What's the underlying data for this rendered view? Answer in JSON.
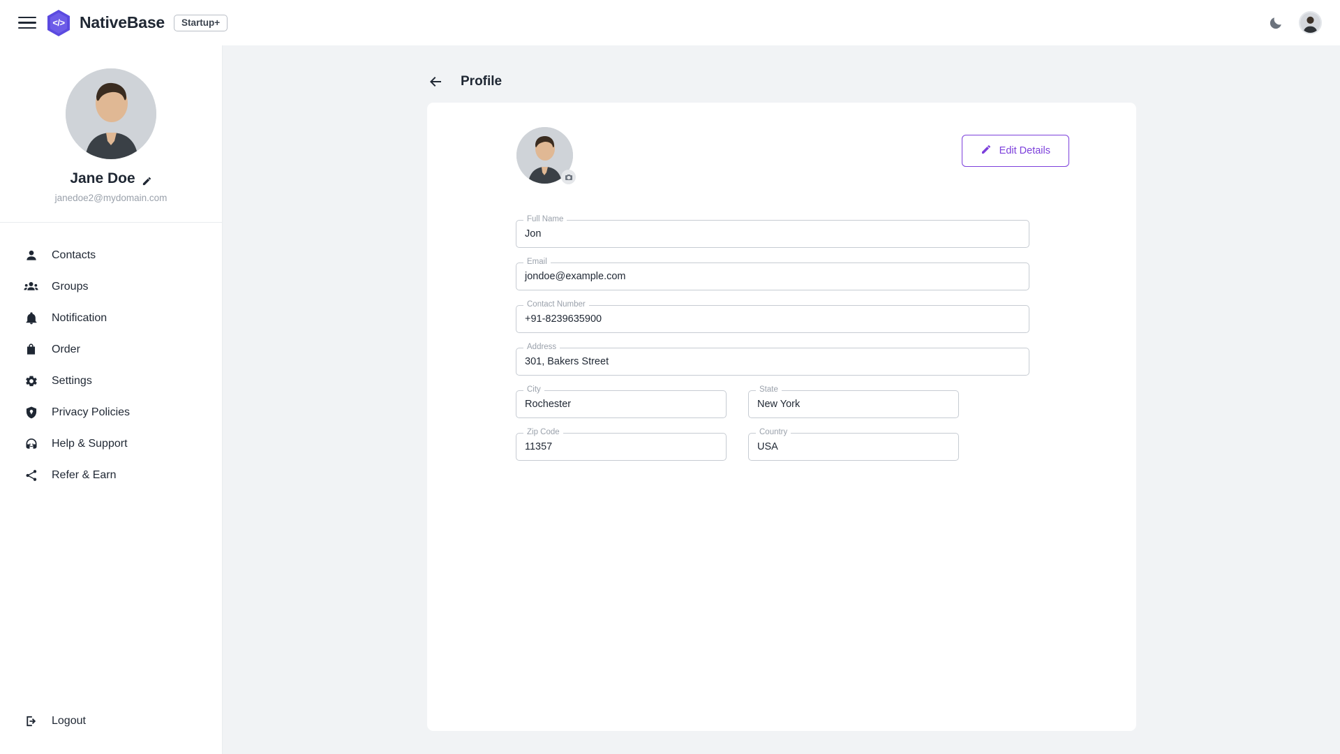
{
  "topbar": {
    "menu_icon": "hamburger-menu-icon",
    "logo_icon": "nativebase-hexagon-logo",
    "logo_glyph": "</>",
    "brand": "NativeBase",
    "badge": "Startup+",
    "theme_toggle_icon": "moon-icon",
    "avatar_icon": "user-avatar"
  },
  "sidebar": {
    "profile": {
      "name": "Jane Doe",
      "email": "janedoe2@mydomain.com",
      "edit_icon": "pencil-icon",
      "avatar_icon": "profile-photo"
    },
    "items": [
      {
        "label": "Contacts",
        "icon": "person-icon"
      },
      {
        "label": "Groups",
        "icon": "people-group-icon"
      },
      {
        "label": "Notification",
        "icon": "bell-icon"
      },
      {
        "label": "Order",
        "icon": "shopping-bag-icon"
      },
      {
        "label": "Settings",
        "icon": "gear-icon"
      },
      {
        "label": "Privacy Policies",
        "icon": "shield-icon"
      },
      {
        "label": "Help & Support",
        "icon": "headset-icon"
      },
      {
        "label": "Refer & Earn",
        "icon": "share-icon"
      }
    ],
    "logout": {
      "label": "Logout",
      "icon": "logout-arrow-icon"
    }
  },
  "page": {
    "back_icon": "back-arrow-icon",
    "title": "Profile"
  },
  "profile_card": {
    "avatar_icon": "profile-photo",
    "camera_icon": "camera-icon",
    "edit_button": {
      "label": "Edit Details",
      "icon": "pencil-icon"
    }
  },
  "form": {
    "fields": [
      {
        "label": "Full Name",
        "value": "Jon",
        "width": "full"
      },
      {
        "label": "Email",
        "value": "jondoe@example.com",
        "width": "full"
      },
      {
        "label": "Contact Number",
        "value": "+91-8239635900",
        "width": "full"
      },
      {
        "label": "Address",
        "value": "301, Bakers Street",
        "width": "full"
      }
    ],
    "rows": [
      [
        {
          "label": "City",
          "value": "Rochester"
        },
        {
          "label": "State",
          "value": "New York"
        }
      ],
      [
        {
          "label": "Zip Code",
          "value": "11357"
        },
        {
          "label": "Country",
          "value": "USA"
        }
      ]
    ]
  },
  "colors": {
    "accent_purple": "#7c3fdb",
    "logo_purple": "#5b4ae0",
    "page_background": "#f1f3f5",
    "card_background": "#ffffff",
    "text_primary": "#1f2733",
    "text_muted": "#9aa1ab"
  }
}
